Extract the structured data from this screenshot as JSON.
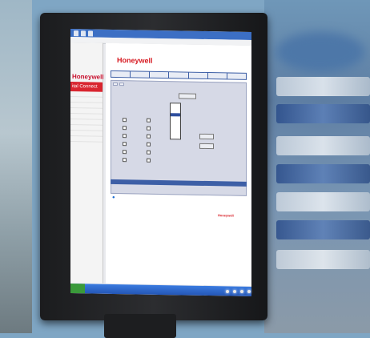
{
  "browser": {
    "tabs": [
      "",
      "",
      ""
    ],
    "address": ""
  },
  "sidebar": {
    "logo": "Honeywell",
    "banner": "ital Connect",
    "items": [
      "",
      "",
      "",
      "",
      "",
      "",
      "",
      "",
      ""
    ]
  },
  "page": {
    "logo": "Honeywell",
    "nav_tabs": [
      "",
      "",
      "",
      "",
      "",
      "",
      ""
    ],
    "sub_tabs": [
      "",
      ""
    ],
    "footer_logo": "Honeywell"
  },
  "colors": {
    "brand_red": "#d71920",
    "nav_blue": "#3d5fa6",
    "taskbar_blue": "#2456b6"
  }
}
